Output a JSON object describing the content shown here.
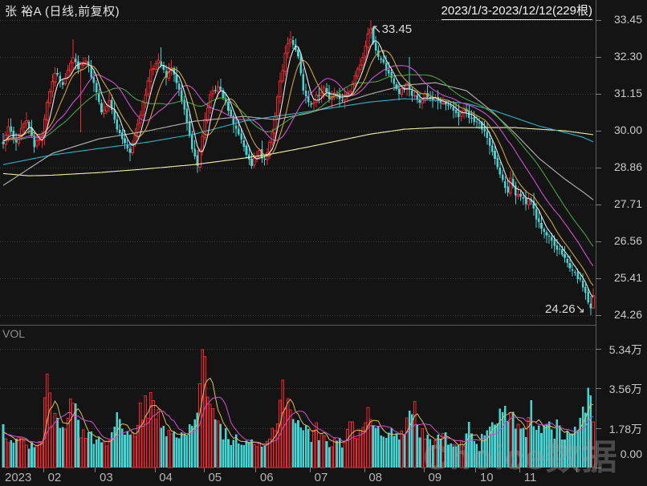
{
  "header": {
    "title": "张  裕A (日线,前复权)",
    "range_label": "2023/1/3-2023/12/12(229根)"
  },
  "watermark": "Choice数据",
  "volume_pane": {
    "label": "VOL"
  },
  "annotations": {
    "high": "33.45",
    "high_arrow": "↖",
    "low": "24.26",
    "low_arrow": "↘"
  },
  "colors": {
    "background": "#141414",
    "up": "#f5262e",
    "down": "#45d4d4",
    "ma5": "#e8e8e8",
    "ma10": "#cfa23c",
    "ma20": "#d14fd1",
    "ma30": "#44a344",
    "ma60": "#b5b5b5",
    "ma120": "#2fb3c9",
    "ma250": "#f3f3a9",
    "vol_ma5": "#ddc05a",
    "vol_ma10": "#d14fd1",
    "grid": "#3e3e3e",
    "axis_line": "#5a5a5a",
    "tick": "#808080",
    "text": "#c9c9c9"
  },
  "chart_data": {
    "type": "candlestick+volume",
    "title": "张  裕A (日线,前复权)",
    "range_label": "2023/1/3-2023/12/12(229根)",
    "bar_count": 229,
    "price_axis": {
      "ticks": [
        {
          "label": "33.45",
          "value": 33.45
        },
        {
          "label": "32.30",
          "value": 32.3
        },
        {
          "label": "31.15",
          "value": 31.15
        },
        {
          "label": "30.00",
          "value": 30.0
        },
        {
          "label": "28.86",
          "value": 28.86
        },
        {
          "label": "27.71",
          "value": 27.71
        },
        {
          "label": "26.56",
          "value": 26.56
        },
        {
          "label": "25.41",
          "value": 25.41
        },
        {
          "label": "24.26",
          "value": 24.26
        }
      ],
      "high": 33.45,
      "low": 24.26
    },
    "volume_axis": {
      "unit": "万",
      "ticks": [
        {
          "label": "5.34万",
          "value": 5.34
        },
        {
          "label": "3.56万",
          "value": 3.56
        },
        {
          "label": "1.78万",
          "value": 1.78
        },
        {
          "label": "0.00",
          "value": 0
        }
      ]
    },
    "x_axis": {
      "months": [
        {
          "label": "2023",
          "idx": 0
        },
        {
          "label": "02",
          "idx": 16
        },
        {
          "label": "03",
          "idx": 36
        },
        {
          "label": "04",
          "idx": 59
        },
        {
          "label": "05",
          "idx": 78
        },
        {
          "label": "06",
          "idx": 98
        },
        {
          "label": "07",
          "idx": 119
        },
        {
          "label": "08",
          "idx": 140
        },
        {
          "label": "09",
          "idx": 163
        },
        {
          "label": "10",
          "idx": 183
        },
        {
          "label": "11",
          "idx": 200
        },
        {
          "label": "",
          "idx": 222
        }
      ]
    },
    "ma_lines": [
      {
        "name": "MA5",
        "period": 5,
        "source": "computed",
        "color_key": "ma5"
      },
      {
        "name": "MA10",
        "period": 10,
        "source": "computed",
        "color_key": "ma10"
      },
      {
        "name": "MA20",
        "period": 20,
        "source": "computed",
        "color_key": "ma20"
      },
      {
        "name": "MA30",
        "period": 30,
        "source": "computed",
        "color_key": "ma30"
      },
      {
        "name": "MA60",
        "period": 60,
        "source": "path",
        "color_key": "ma60"
      },
      {
        "name": "MA120",
        "period": 120,
        "source": "path",
        "color_key": "ma120"
      },
      {
        "name": "MA250",
        "period": 250,
        "source": "path",
        "color_key": "ma250"
      }
    ],
    "price_path": [
      [
        0,
        29.6
      ],
      [
        2,
        30.05
      ],
      [
        5,
        29.7
      ],
      [
        9,
        30.3
      ],
      [
        12,
        29.55
      ],
      [
        15,
        29.85
      ],
      [
        17,
        30.9
      ],
      [
        20,
        31.8
      ],
      [
        23,
        31.5
      ],
      [
        27,
        32.3
      ],
      [
        29,
        31.9
      ],
      [
        32,
        32.2
      ],
      [
        35,
        31.5
      ],
      [
        38,
        30.6
      ],
      [
        41,
        30.9
      ],
      [
        44,
        30.1
      ],
      [
        47,
        29.6
      ],
      [
        49,
        29.35
      ],
      [
        53,
        30.5
      ],
      [
        57,
        31.9
      ],
      [
        60,
        32.2
      ],
      [
        63,
        31.7
      ],
      [
        65,
        32.0
      ],
      [
        68,
        31.3
      ],
      [
        70,
        30.7
      ],
      [
        73,
        29.5
      ],
      [
        75,
        28.9
      ],
      [
        78,
        30.3
      ],
      [
        80,
        31.1
      ],
      [
        83,
        31.4
      ],
      [
        87,
        30.7
      ],
      [
        90,
        30.0
      ],
      [
        94,
        29.3
      ],
      [
        96,
        28.95
      ],
      [
        99,
        29.35
      ],
      [
        101,
        29.1
      ],
      [
        104,
        29.9
      ],
      [
        106,
        31.0
      ],
      [
        109,
        32.4
      ],
      [
        111,
        32.9
      ],
      [
        114,
        32.3
      ],
      [
        116,
        31.3
      ],
      [
        119,
        30.8
      ],
      [
        121,
        31.1
      ],
      [
        124,
        31.3
      ],
      [
        126,
        31.0
      ],
      [
        129,
        31.2
      ],
      [
        131,
        30.9
      ],
      [
        134,
        31.3
      ],
      [
        136,
        31.7
      ],
      [
        139,
        32.3
      ],
      [
        141,
        33.0
      ],
      [
        142,
        33.15
      ],
      [
        143,
        32.7
      ],
      [
        146,
        32.2
      ],
      [
        148,
        31.9
      ],
      [
        151,
        31.5
      ],
      [
        153,
        31.2
      ],
      [
        156,
        31.4
      ],
      [
        158,
        31.1
      ],
      [
        161,
        30.9
      ],
      [
        163,
        31.1
      ],
      [
        166,
        30.9
      ],
      [
        168,
        31.0
      ],
      [
        171,
        30.8
      ],
      [
        173,
        30.7
      ],
      [
        176,
        30.5
      ],
      [
        178,
        30.6
      ],
      [
        181,
        30.4
      ],
      [
        183,
        30.3
      ],
      [
        186,
        29.9
      ],
      [
        188,
        29.5
      ],
      [
        190,
        29.15
      ],
      [
        193,
        28.5
      ],
      [
        195,
        28.1
      ],
      [
        196,
        28.55
      ],
      [
        198,
        27.95
      ],
      [
        200,
        28.0
      ],
      [
        202,
        27.7
      ],
      [
        203,
        27.95
      ],
      [
        206,
        27.3
      ],
      [
        208,
        26.9
      ],
      [
        211,
        26.65
      ],
      [
        213,
        26.45
      ],
      [
        216,
        26.2
      ],
      [
        218,
        25.9
      ],
      [
        221,
        25.6
      ],
      [
        223,
        25.3
      ],
      [
        225,
        24.95
      ],
      [
        227,
        24.5
      ],
      [
        228,
        24.95
      ]
    ],
    "overrides": {
      "27": {
        "high": 32.85
      },
      "30": {
        "low": 29.95
      },
      "61": {
        "high": 32.6
      },
      "111": {
        "high": 33.1
      },
      "142": {
        "high": 33.45
      },
      "157": {
        "high": 32.3
      },
      "227": {
        "low": 24.26
      }
    },
    "ma60_path": [
      [
        0,
        28.3
      ],
      [
        19,
        29.3
      ],
      [
        37,
        29.75
      ],
      [
        56,
        30.0
      ],
      [
        74,
        30.3
      ],
      [
        93,
        30.45
      ],
      [
        105,
        30.35
      ],
      [
        118,
        30.55
      ],
      [
        130,
        30.85
      ],
      [
        142,
        31.15
      ],
      [
        155,
        31.42
      ],
      [
        167,
        31.5
      ],
      [
        179,
        31.25
      ],
      [
        189,
        30.6
      ],
      [
        198,
        29.9
      ],
      [
        207,
        29.15
      ],
      [
        217,
        28.5
      ],
      [
        224,
        28.1
      ],
      [
        228,
        27.85
      ]
    ],
    "ma120_path": [
      [
        0,
        28.95
      ],
      [
        19,
        29.25
      ],
      [
        37,
        29.45
      ],
      [
        56,
        29.65
      ],
      [
        74,
        29.9
      ],
      [
        93,
        30.3
      ],
      [
        105,
        30.45
      ],
      [
        118,
        30.6
      ],
      [
        130,
        30.75
      ],
      [
        142,
        30.9
      ],
      [
        155,
        31.0
      ],
      [
        167,
        30.95
      ],
      [
        179,
        30.85
      ],
      [
        189,
        30.65
      ],
      [
        198,
        30.4
      ],
      [
        207,
        30.15
      ],
      [
        217,
        29.95
      ],
      [
        224,
        29.8
      ],
      [
        228,
        29.66
      ]
    ],
    "ma250_path": [
      [
        0,
        28.67
      ],
      [
        10,
        28.6
      ],
      [
        19,
        28.62
      ],
      [
        37,
        28.7
      ],
      [
        56,
        28.82
      ],
      [
        74,
        28.95
      ],
      [
        93,
        29.15
      ],
      [
        105,
        29.3
      ],
      [
        118,
        29.5
      ],
      [
        130,
        29.7
      ],
      [
        142,
        29.9
      ],
      [
        155,
        30.05
      ],
      [
        167,
        30.1
      ],
      [
        189,
        30.1
      ],
      [
        198,
        30.1
      ],
      [
        207,
        30.05
      ],
      [
        217,
        30.0
      ],
      [
        228,
        29.88
      ]
    ],
    "volume_path": [
      [
        0,
        1.6
      ],
      [
        2,
        1.4
      ],
      [
        5,
        1.2
      ],
      [
        9,
        1.1
      ],
      [
        12,
        0.9
      ],
      [
        15,
        1.1
      ],
      [
        17,
        4.2
      ],
      [
        19,
        2.2
      ],
      [
        23,
        1.6
      ],
      [
        27,
        3.2
      ],
      [
        30,
        1.6
      ],
      [
        33,
        1.5
      ],
      [
        35,
        1.3
      ],
      [
        38,
        1.1
      ],
      [
        41,
        1.2
      ],
      [
        44,
        2.3
      ],
      [
        47,
        1.5
      ],
      [
        50,
        1.3
      ],
      [
        53,
        2.6
      ],
      [
        57,
        2.9
      ],
      [
        60,
        2.2
      ],
      [
        63,
        1.7
      ],
      [
        66,
        2.0
      ],
      [
        68,
        1.4
      ],
      [
        71,
        1.3
      ],
      [
        73,
        2.0
      ],
      [
        75,
        2.6
      ],
      [
        77,
        5.3
      ],
      [
        78,
        5.0
      ],
      [
        80,
        2.6
      ],
      [
        83,
        1.9
      ],
      [
        87,
        1.3
      ],
      [
        90,
        1.3
      ],
      [
        94,
        1.0
      ],
      [
        97,
        1.1
      ],
      [
        99,
        0.9
      ],
      [
        101,
        0.85
      ],
      [
        104,
        1.6
      ],
      [
        106,
        2.3
      ],
      [
        108,
        3.6
      ],
      [
        110,
        3.0
      ],
      [
        112,
        2.4
      ],
      [
        114,
        2.0
      ],
      [
        116,
        1.8
      ],
      [
        119,
        1.4
      ],
      [
        121,
        1.7
      ],
      [
        124,
        1.2
      ],
      [
        126,
        1.1
      ],
      [
        129,
        1.4
      ],
      [
        131,
        1.0
      ],
      [
        134,
        1.9
      ],
      [
        136,
        1.5
      ],
      [
        139,
        1.9
      ],
      [
        141,
        2.4
      ],
      [
        143,
        2.1
      ],
      [
        146,
        1.8
      ],
      [
        148,
        1.6
      ],
      [
        151,
        1.4
      ],
      [
        153,
        1.3
      ],
      [
        156,
        1.9
      ],
      [
        158,
        3.0
      ],
      [
        161,
        1.6
      ],
      [
        163,
        1.4
      ],
      [
        166,
        1.3
      ],
      [
        168,
        1.5
      ],
      [
        170,
        1.4
      ],
      [
        173,
        1.2
      ],
      [
        176,
        1.1
      ],
      [
        178,
        1.0
      ],
      [
        180,
        2.5
      ],
      [
        182,
        1.2
      ],
      [
        184,
        0.9
      ],
      [
        186,
        1.6
      ],
      [
        188,
        1.8
      ],
      [
        190,
        1.7
      ],
      [
        193,
        2.5
      ],
      [
        195,
        2.3
      ],
      [
        197,
        2.1
      ],
      [
        200,
        1.6
      ],
      [
        202,
        1.5
      ],
      [
        204,
        2.7
      ],
      [
        206,
        1.6
      ],
      [
        208,
        1.8
      ],
      [
        211,
        2.0
      ],
      [
        213,
        1.6
      ],
      [
        214,
        1.9
      ],
      [
        216,
        1.5
      ],
      [
        218,
        1.7
      ],
      [
        221,
        1.6
      ],
      [
        223,
        2.1
      ],
      [
        225,
        2.7
      ],
      [
        226,
        3.6
      ],
      [
        227,
        3.25
      ],
      [
        228,
        1.95
      ]
    ],
    "volume_overrides": {
      "17": 4.2,
      "77": 5.3,
      "78": 5.0,
      "226": 3.6,
      "227": 3.25
    },
    "vol_ma_periods": [
      5,
      10
    ]
  }
}
